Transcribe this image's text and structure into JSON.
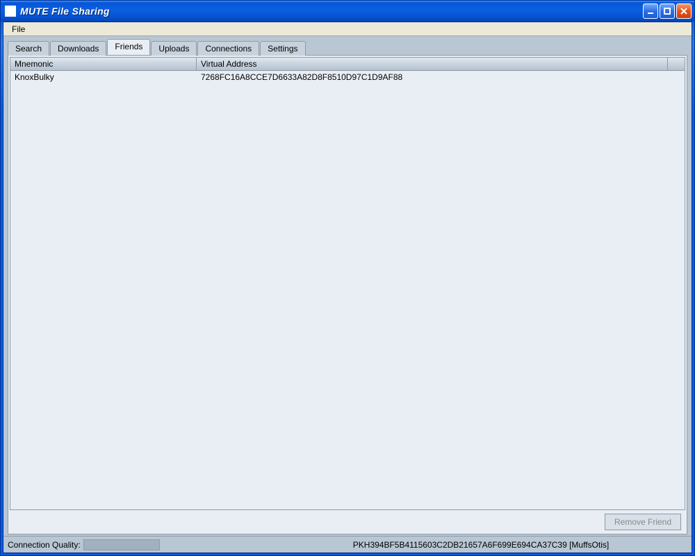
{
  "window": {
    "title": "MUTE File Sharing"
  },
  "menubar": {
    "file": "File"
  },
  "tabs": [
    {
      "label": "Search"
    },
    {
      "label": "Downloads"
    },
    {
      "label": "Friends",
      "active": true
    },
    {
      "label": "Uploads"
    },
    {
      "label": "Connections"
    },
    {
      "label": "Settings"
    }
  ],
  "friends": {
    "columns": {
      "mnemonic": "Mnemonic",
      "address": "Virtual Address"
    },
    "rows": [
      {
        "mnemonic": "KnoxBulky",
        "address": "7268FC16A8CCE7D6633A82D8F8510D97C1D9AF88"
      }
    ],
    "remove_button": "Remove Friend"
  },
  "statusbar": {
    "quality_label": "Connection Quality:",
    "identity": "PKH394BF5B4115603C2DB21657A6F699E694CA37C39 [MuffsOtis]"
  }
}
